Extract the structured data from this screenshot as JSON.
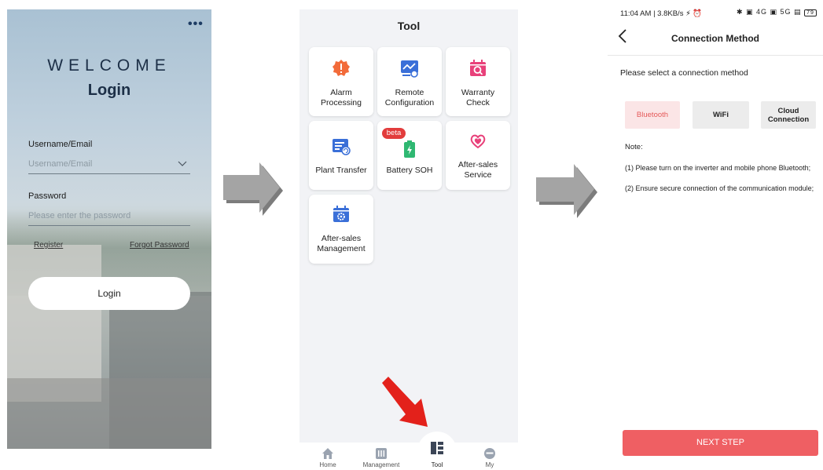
{
  "login_screen": {
    "more_icon": "more-dots-icon",
    "welcome": "WELCOME",
    "title": "Login",
    "username_label": "Username/Email",
    "username_placeholder": "Username/Email",
    "password_label": "Password",
    "password_placeholder": "Please enter the password",
    "register_link": "Register",
    "forgot_link": "Forgot Password",
    "login_button": "Login"
  },
  "tool_screen": {
    "title": "Tool",
    "tools": [
      {
        "label": "Alarm Processing",
        "icon": "alarm-badge-icon",
        "color": "#f26b3a"
      },
      {
        "label": "Remote Configuration",
        "icon": "remote-config-icon",
        "color": "#3a6fd8"
      },
      {
        "label": "Warranty Check",
        "icon": "calendar-search-icon",
        "color": "#e8417a"
      },
      {
        "label": "Plant Transfer",
        "icon": "plant-transfer-icon",
        "color": "#3a6fd8"
      },
      {
        "label": "Battery SOH",
        "icon": "battery-icon",
        "color": "#2fb872",
        "badge": "beta"
      },
      {
        "label": "After-sales Service",
        "icon": "heart-hand-icon",
        "color": "#e8417a"
      },
      {
        "label": "After-sales Management",
        "icon": "calendar-gear-icon",
        "color": "#3a6fd8"
      }
    ],
    "tabs": [
      {
        "label": "Home",
        "icon": "home-icon"
      },
      {
        "label": "Management",
        "icon": "management-icon"
      },
      {
        "label": "Tool",
        "icon": "tool-grid-icon"
      },
      {
        "label": "My",
        "icon": "profile-icon"
      }
    ],
    "active_tab": "Tool"
  },
  "connection_screen": {
    "status_time": "11:04 AM | 3.8KB/s",
    "status_icons": "✱ ▣ 4G ▣ 5G ▤",
    "battery": "79",
    "title": "Connection Method",
    "prompt": "Please select a connection method",
    "options": [
      {
        "line1": "Bluetooth",
        "line2": "",
        "selected": true
      },
      {
        "line1": "WiFi",
        "line2": "",
        "selected": false
      },
      {
        "line1": "Cloud",
        "line2": "Connection",
        "selected": false
      }
    ],
    "note_heading": "Note:",
    "note_line1": "(1) Please turn on the inverter and mobile phone Bluetooth;",
    "note_line2": "(2) Ensure secure connection of the communication module;",
    "next_button": "NEXT STEP"
  },
  "colors": {
    "accent_red": "#ef5f63",
    "arrow_gray": "#a4a4a4",
    "highlight_arrow": "#e3211b"
  }
}
